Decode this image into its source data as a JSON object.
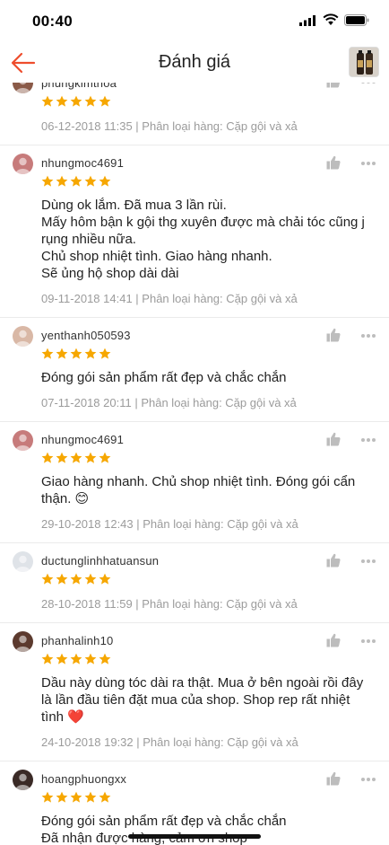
{
  "status_bar": {
    "time": "00:40"
  },
  "header": {
    "title": "Đánh giá"
  },
  "colors": {
    "accent": "#ee4d2d",
    "star": "#f6a700",
    "muted": "#9b9b9b"
  },
  "reviews": [
    {
      "username": "phungkimthoa",
      "stars": 5,
      "comment": "",
      "date": "06-12-2018 11:35",
      "variation": "Phân loại hàng: Cặp gội và xả",
      "avatar_color": "#8a5a48"
    },
    {
      "username": "nhungmoc4691",
      "stars": 5,
      "comment": "Dùng ok lắm. Đã mua 3 lần rùi.\nMấy hôm bận k gội thg xuyên được mà chải tóc cũng j rụng nhiều nữa.\nChủ shop nhiệt tình. Giao hàng nhanh.\nSẽ ủng hộ shop dài dài",
      "date": "09-11-2018 14:41",
      "variation": "Phân loại hàng: Cặp gội và xả",
      "avatar_color": "#c77b7b"
    },
    {
      "username": "yenthanh050593",
      "stars": 5,
      "comment": " Đóng gói sản phẩm rất đẹp và chắc chắn",
      "date": "07-11-2018 20:11",
      "variation": "Phân loại hàng: Cặp gội và xả",
      "avatar_color": "#d9b8a6"
    },
    {
      "username": "nhungmoc4691",
      "stars": 5,
      "comment": "Giao hàng nhanh. Chủ shop nhiệt tình. Đóng gói cẩn thận. 😊",
      "date": "29-10-2018 12:43",
      "variation": "Phân loại hàng: Cặp gội và xả",
      "avatar_color": "#c77b7b"
    },
    {
      "username": "ductunglinhhatuansun",
      "stars": 5,
      "comment": "",
      "date": "28-10-2018 11:59",
      "variation": "Phân loại hàng: Cặp gội và xả",
      "avatar_color": "#dfe3e8"
    },
    {
      "username": "phanhalinh10",
      "stars": 5,
      "comment": "Dầu này dùng tóc dài ra thật. Mua ở bên ngoài rồi đây là lần đầu tiên đặt mua của shop. Shop rep rất nhiệt tình ❤️",
      "date": "24-10-2018 19:32",
      "variation": "Phân loại hàng: Cặp gội và xả",
      "avatar_color": "#5c3a2e"
    },
    {
      "username": "hoangphuongxx",
      "stars": 5,
      "comment": " Đóng gói sản phẩm rất đẹp và chắc chắn\n Đã nhận được hàng, cảm ơn shop",
      "date": "",
      "variation": "",
      "avatar_color": "#3a2a26"
    }
  ]
}
